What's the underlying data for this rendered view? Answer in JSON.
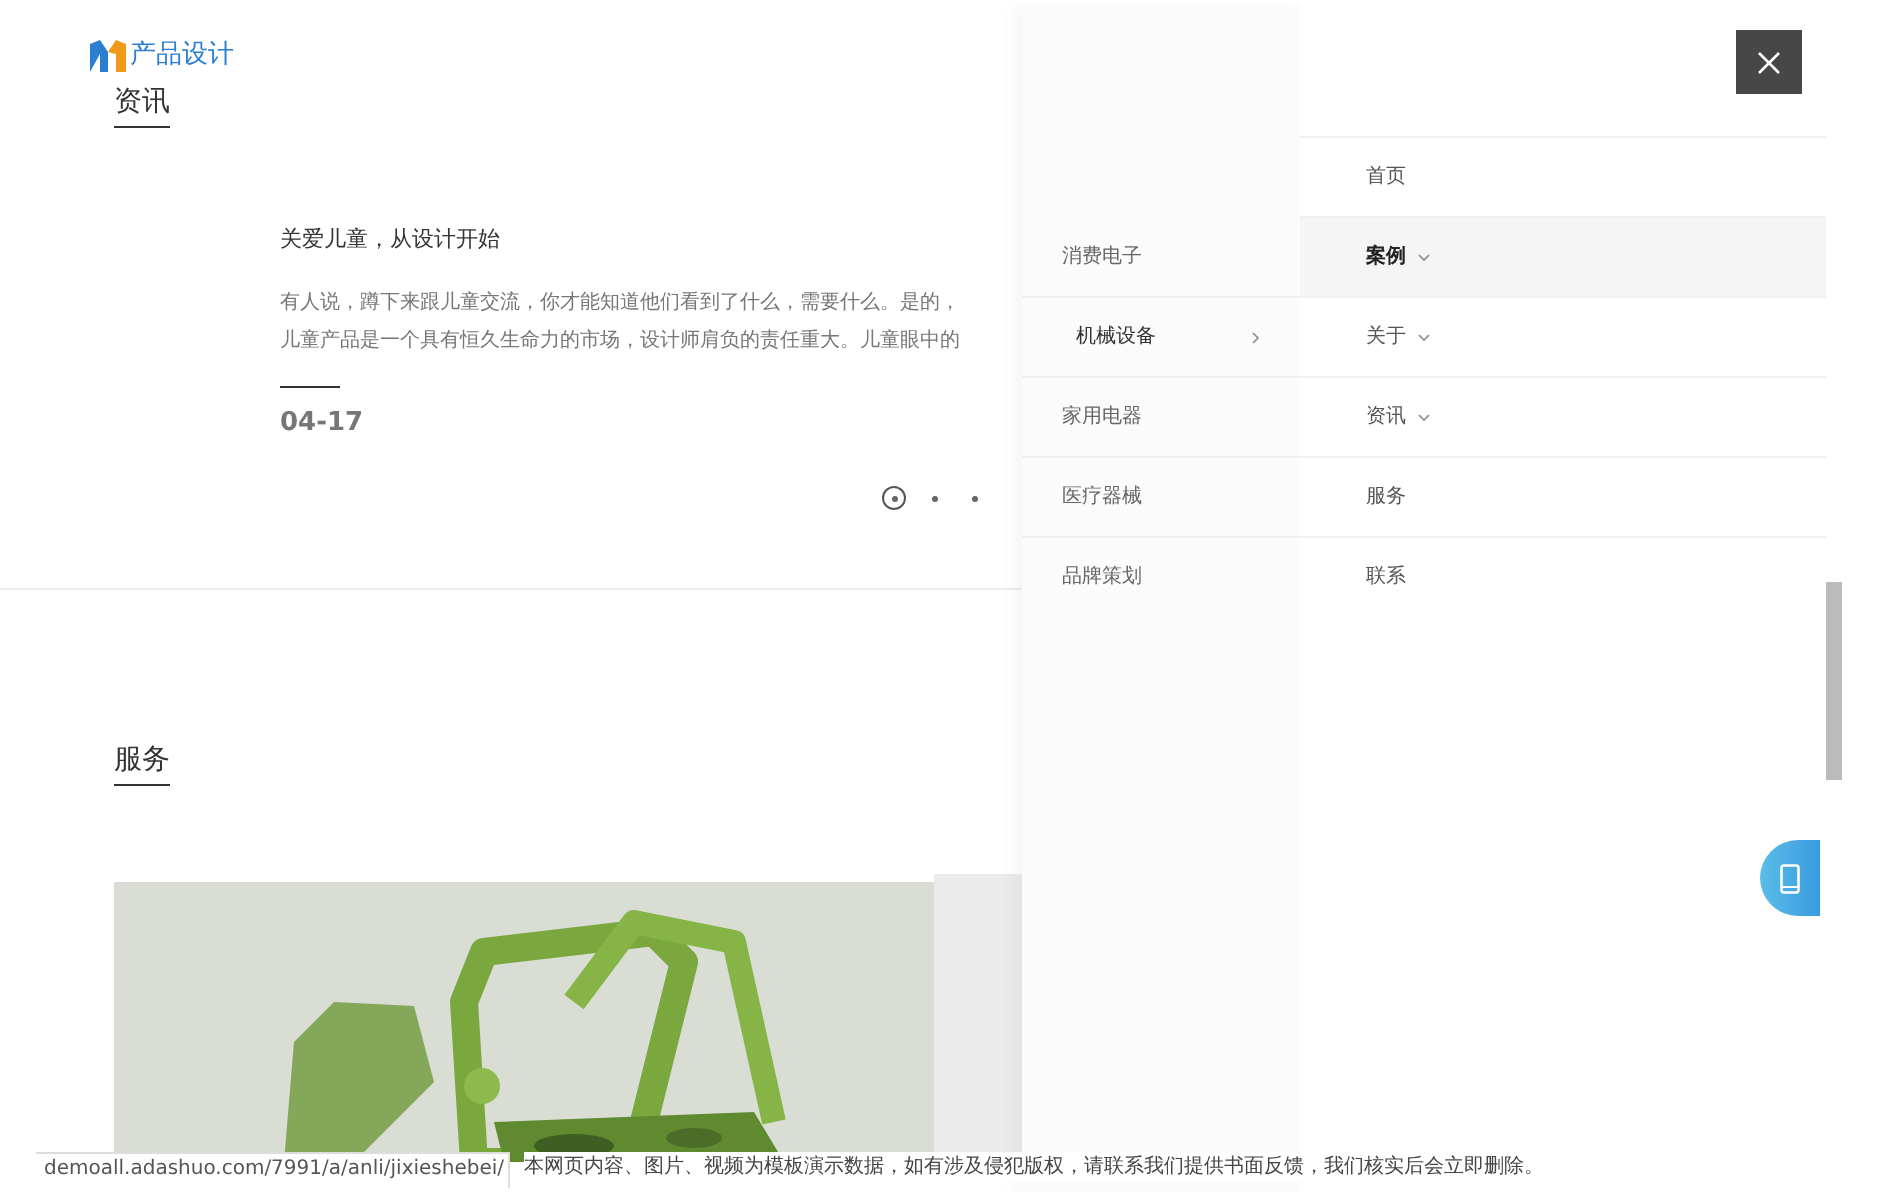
{
  "logo": {
    "text": "产品设计"
  },
  "news": {
    "title": "资讯",
    "articles": [
      {
        "title": "关爱儿童，从设计开始",
        "description_lines": [
          "有人说，蹲下来跟儿童交流，你才能知道他们看到了什么，需要什么。是的，",
          "儿童产品是一个具有恒久生命力的市场，设计师肩负的责任重大。儿童眼中的"
        ],
        "date": "04-17"
      }
    ],
    "dots": [
      {
        "selected": true
      },
      {
        "selected": false
      },
      {
        "selected": false
      }
    ]
  },
  "services": {
    "title": "服务"
  },
  "menu": {
    "items": [
      {
        "label": "首页",
        "selected": false,
        "has_submenu": false
      },
      {
        "label": "案例",
        "selected": true,
        "has_submenu": true
      },
      {
        "label": "关于",
        "selected": false,
        "has_submenu": true
      },
      {
        "label": "资讯",
        "selected": false,
        "has_submenu": true
      },
      {
        "label": "服务",
        "selected": false,
        "has_submenu": false
      },
      {
        "label": "联系",
        "selected": false,
        "has_submenu": false
      }
    ],
    "submenu": [
      {
        "label": "消费电子",
        "selected": false
      },
      {
        "label": "机械设备",
        "selected": true
      },
      {
        "label": "家用电器",
        "selected": false
      },
      {
        "label": "医疗器械",
        "selected": false
      },
      {
        "label": "品牌策划",
        "selected": false
      }
    ]
  },
  "status_url": "demoall.adashuo.com/7991/a/anli/jixieshebei/",
  "notice": "本网页内容、图片、视频为模板演示数据，如有涉及侵犯版权，请联系我们提供书面反馈，我们核实后会立即删除。"
}
